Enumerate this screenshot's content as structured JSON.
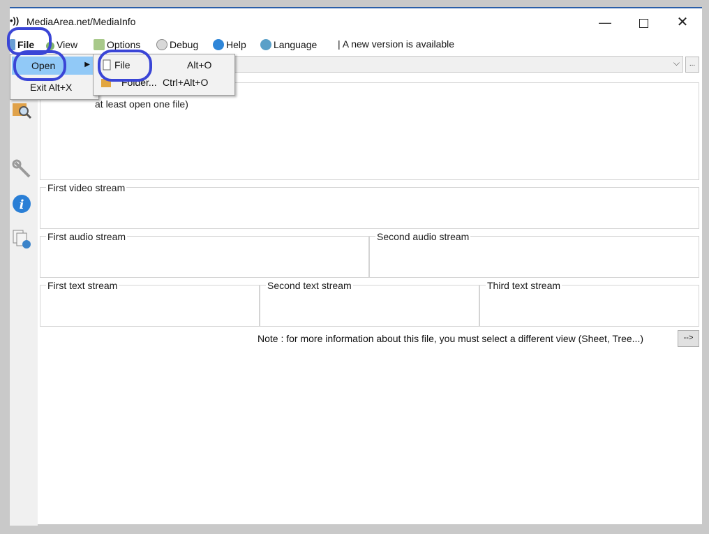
{
  "window": {
    "title": "MediaArea.net/MediaInfo",
    "controls": {
      "minimize": "—",
      "close": "✕"
    }
  },
  "menubar": {
    "items": [
      {
        "label": "File",
        "icon": "file-icon"
      },
      {
        "label": "View",
        "icon": "view-icon"
      },
      {
        "label": "Options",
        "icon": "options-icon"
      },
      {
        "label": "Debug",
        "icon": "debug-icon"
      },
      {
        "label": "Help",
        "icon": "help-icon"
      },
      {
        "label": "Language",
        "icon": "language-icon"
      }
    ],
    "news": "| A new version is available"
  },
  "file_menu": {
    "open_label": "Open",
    "exit_label": "Exit Alt+X"
  },
  "open_submenu": {
    "file_label": "File",
    "file_shortcut": "Alt+O",
    "folder_label": "Folder...",
    "folder_shortcut": "Ctrl+Alt+O"
  },
  "combo": {
    "more_label": "..."
  },
  "main": {
    "general_hint": "at least open one file)",
    "groups": {
      "video": "First video stream",
      "audio1": "First audio stream",
      "audio2": "Second audio stream",
      "text1": "First text stream",
      "text2": "Second text stream",
      "text3": "Third text stream"
    },
    "note": "Note : for more information about this file, you must select a different view (Sheet, Tree...)",
    "arrow_button": "-->"
  },
  "colors": {
    "annotation": "#3a45d6",
    "menu_highlight": "#91c9f7",
    "title_border": "#2a5ea8"
  }
}
